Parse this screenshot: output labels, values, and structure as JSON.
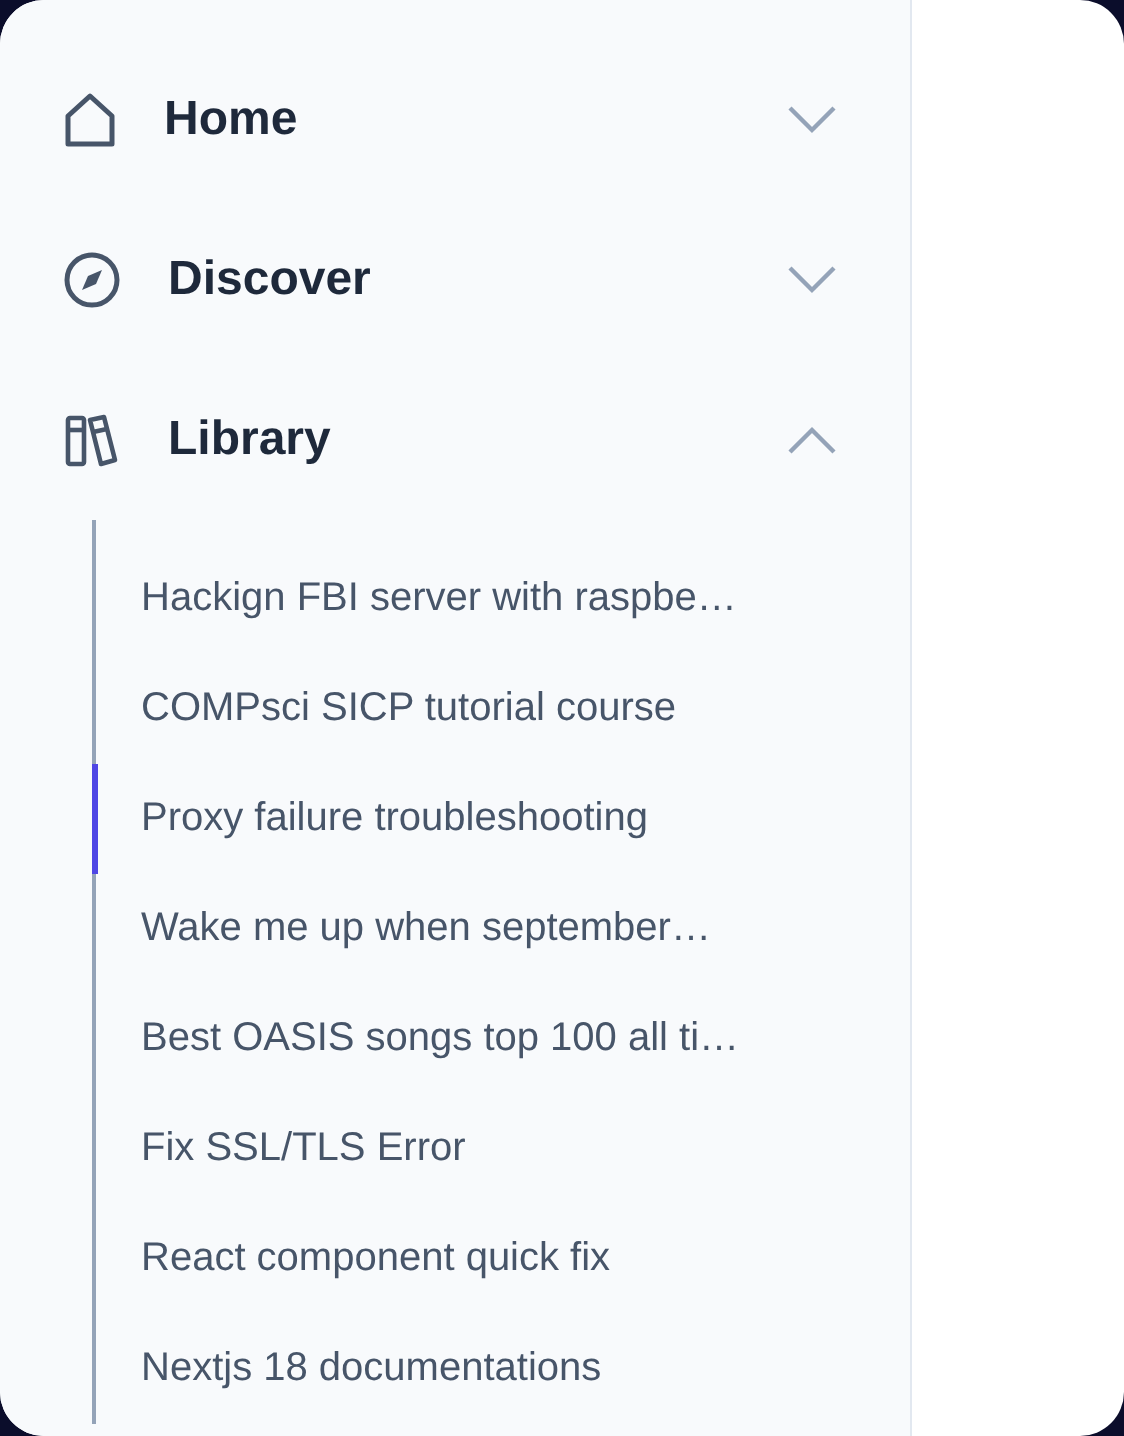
{
  "nav": [
    {
      "label": "Home",
      "kind": "home",
      "expanded": false
    },
    {
      "label": "Discover",
      "kind": "discover",
      "expanded": false
    },
    {
      "label": "Library",
      "kind": "library",
      "expanded": true,
      "children": [
        {
          "label": "Hackign FBI server with raspbe…",
          "selected": false
        },
        {
          "label": "COMPsci SICP tutorial course",
          "selected": false
        },
        {
          "label": "Proxy failure troubleshooting",
          "selected": true
        },
        {
          "label": "Wake me up when september…",
          "selected": false
        },
        {
          "label": "Best OASIS songs top 100 all ti…",
          "selected": false
        },
        {
          "label": "Fix SSL/TLS Error",
          "selected": false
        },
        {
          "label": "React component quick fix",
          "selected": false
        },
        {
          "label": "Nextjs 18 documentations",
          "selected": false
        }
      ]
    }
  ]
}
